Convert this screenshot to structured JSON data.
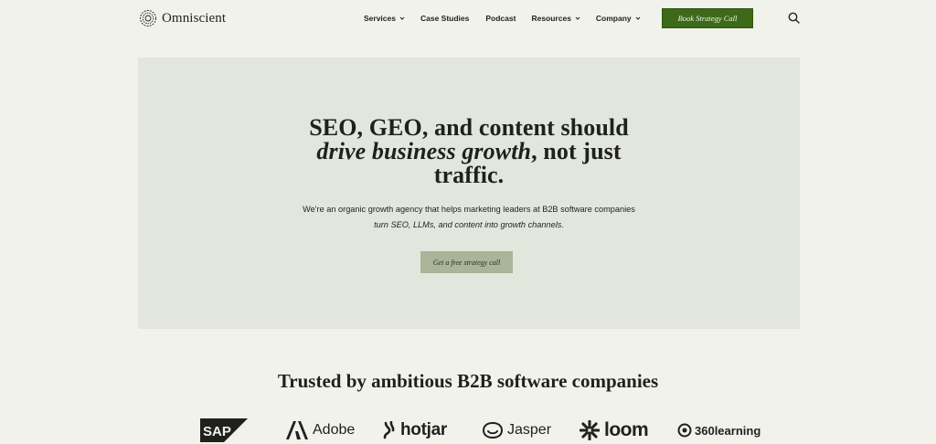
{
  "brand": {
    "name": "Omniscient"
  },
  "nav": {
    "items": [
      {
        "label": "Services",
        "has_dropdown": true
      },
      {
        "label": "Case Studies",
        "has_dropdown": false
      },
      {
        "label": "Podcast",
        "has_dropdown": false
      },
      {
        "label": "Resources",
        "has_dropdown": true
      },
      {
        "label": "Company",
        "has_dropdown": true
      }
    ],
    "cta_label": "Book Strategy Call",
    "search_icon": "search-icon"
  },
  "hero": {
    "title_line1": "SEO, GEO, and content should",
    "title_line2_italic": "drive business growth",
    "title_line2_rest": ", not just",
    "title_line3": "traffic.",
    "subtitle_line1": "We're an organic growth agency that helps marketing leaders at B2B software companies",
    "subtitle_line2_italic": "turn SEO, LLMs, and content into growth channels.",
    "cta_label": "Get a free strategy call"
  },
  "trusted": {
    "title": "Trusted by ambitious B2B software companies",
    "logos": [
      {
        "name": "SAP",
        "label": "SAP"
      },
      {
        "name": "Adobe",
        "label": "Adobe"
      },
      {
        "name": "Hotjar",
        "label": "hotjar"
      },
      {
        "name": "Jasper",
        "label": "Jasper"
      },
      {
        "name": "Loom",
        "label": "loom"
      },
      {
        "name": "360Learning",
        "label": "360learning"
      }
    ]
  },
  "colors": {
    "background": "#f1f2ec",
    "hero_background": "#e3e6dc",
    "primary_cta": "#3d6a18",
    "secondary_cta": "#a9b499",
    "text": "#1f211c"
  }
}
